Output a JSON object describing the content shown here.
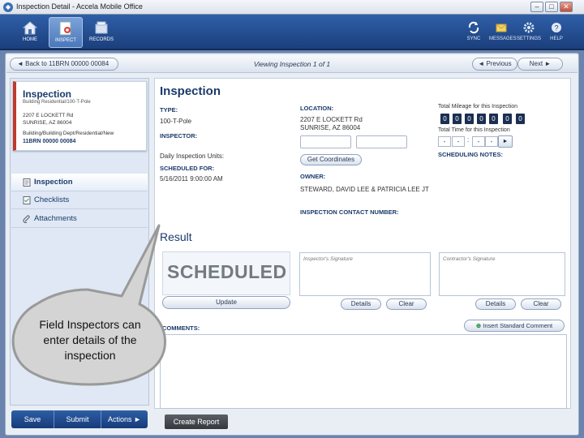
{
  "window": {
    "title": "Inspection Detail - Accela Mobile Office"
  },
  "nav": {
    "left": [
      {
        "label": "HOME"
      },
      {
        "label": "INSPECT"
      },
      {
        "label": "RECORDS"
      }
    ],
    "right": [
      {
        "label": "SYNC"
      },
      {
        "label": "MESSAGES"
      },
      {
        "label": "SETTINGS"
      },
      {
        "label": "HELP"
      }
    ]
  },
  "breadcrumb": {
    "back": "Back to 11BRN 00000 00084",
    "viewing": "Viewing Inspection 1 of 1",
    "previous": "Previous",
    "next": "Next"
  },
  "card": {
    "title": "Inspection",
    "subtitle": "Building Residential/100-T-Pole",
    "addr1": "2207 E LOCKETT Rd",
    "addr2": "SUNRISE, AZ 86004",
    "dept": "Building/Building Dept/Residential/New",
    "record": "11BRN 00000 00084"
  },
  "sidebar": {
    "items": [
      {
        "label": "Inspection"
      },
      {
        "label": "Checklists"
      },
      {
        "label": "Attachments"
      }
    ]
  },
  "footer": {
    "save": "Save",
    "submit": "Submit",
    "actions": "Actions",
    "create_report": "Create Report"
  },
  "main": {
    "title": "Inspection",
    "type_label": "TYPE:",
    "type_value": "100-T-Pole",
    "inspector_label": "INSPECTOR:",
    "units_label": "Daily Inspection Units:",
    "scheduled_label": "SCHEDULED FOR:",
    "scheduled_value": "5/16/2011 9:00:00 AM",
    "location_label": "LOCATION:",
    "location_line1": "2207 E LOCKETT Rd",
    "location_line2": "SUNRISE, AZ 86004",
    "get_coordinates": "Get Coordinates",
    "owner_label": "OWNER:",
    "owner_value": "STEWARD, DAVID LEE & PATRICIA LEE JT",
    "contact_label": "INSPECTION CONTACT NUMBER:",
    "mileage_label": "Total Mileage for this Inspection",
    "mileage_digits": [
      "0",
      "0",
      "0",
      "0",
      "0",
      "0",
      "0"
    ],
    "time_label": "Total Time for this Inspection",
    "time_fields": [
      "-",
      "-",
      ":",
      "-",
      "-"
    ],
    "play": "►",
    "scheduling_notes_label": "SCHEDULING NOTES:",
    "result_title": "Result",
    "status": "SCHEDULED",
    "update": "Update",
    "inspector_signature": "Inspector's Signature",
    "contractor_signature": "Contractor's Signature",
    "details": "Details",
    "clear": "Clear",
    "comments_label": "COMMENTS:",
    "insert_comment": "Insert Standard Comment"
  },
  "callout": {
    "text": "Field Inspectors can enter details of the inspection"
  }
}
